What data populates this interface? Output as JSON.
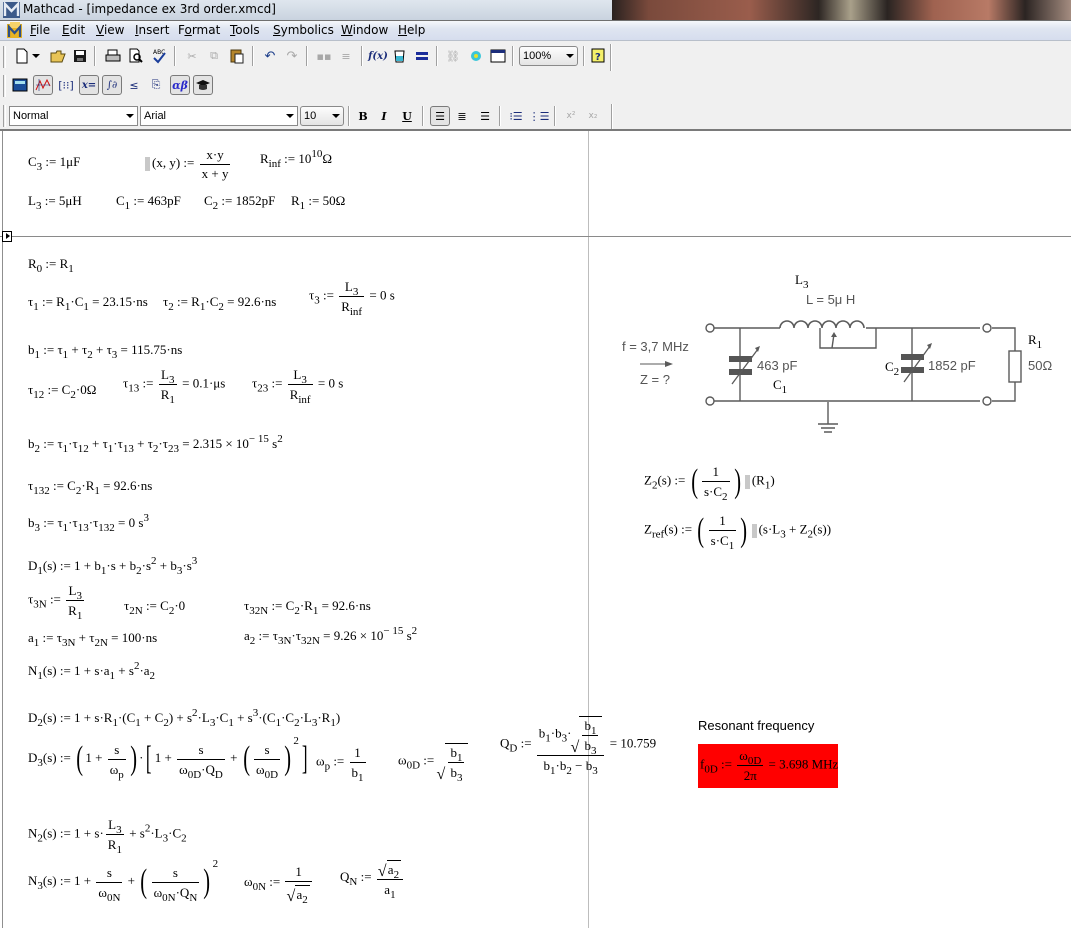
{
  "window": {
    "title": "Mathcad - [impedance ex 3rd order.xmcd]"
  },
  "menu": [
    {
      "label": "File",
      "accel": "F"
    },
    {
      "label": "Edit",
      "accel": "E"
    },
    {
      "label": "View",
      "accel": "V"
    },
    {
      "label": "Insert",
      "accel": "I"
    },
    {
      "label": "Format",
      "accel": "o"
    },
    {
      "label": "Tools",
      "accel": "T"
    },
    {
      "label": "Symbolics",
      "accel": "S"
    },
    {
      "label": "Window",
      "accel": "W"
    },
    {
      "label": "Help",
      "accel": "H"
    }
  ],
  "toolbar": {
    "zoom_value": "100%",
    "style_value": "Normal",
    "font_value": "Arial",
    "size_value": "10",
    "bold_label": "B",
    "italic_label": "I",
    "underline_label": "U"
  },
  "worksheet": {
    "defs_row1": {
      "c3": "C3 := 1μF",
      "parallel_def_args": "(x, y) :=",
      "parallel_num": "x·y",
      "parallel_den": "x + y",
      "rinf_lhs": "R",
      "rinf_sub": "inf",
      "rinf_rhs": " := 10",
      "rinf_exp": "10",
      "rinf_unit": "Ω"
    },
    "defs_row2": {
      "l3_value": "5μH",
      "c1_value": "463pF",
      "c2_value": "1852pF",
      "r1_value": "50Ω"
    },
    "results": {
      "tau1": "23.15·ns",
      "tau2": "92.6·ns",
      "tau3": "0 s",
      "b1": "115.75·ns",
      "tau13": "0.1·μs",
      "tau23": "0 s",
      "b2_mantissa": "2.315 × 10",
      "b2_exp": "− 15",
      "tau132": "92.6·ns",
      "b3": "0 s",
      "tau32N": "92.6·ns",
      "a1": "100·ns",
      "a2_mantissa": "9.26 × 10",
      "a2_exp": "− 15",
      "QD": "10.759",
      "f0D": "3.698 MHz"
    },
    "annotation": {
      "resonant_label": "Resonant frequency"
    },
    "circuit": {
      "inductor_name": "L",
      "inductor_sub": "3",
      "inductor_value": "L = 5μ H",
      "freq_label": "f = 3,7 MHz",
      "z_label": "Z = ?",
      "c1_value": "463 pF",
      "c1_name": "C",
      "c1_sub": "1",
      "c2_name": "C",
      "c2_sub": "2",
      "c2_value": "1852 pF",
      "r1_name": "R",
      "r1_sub": "1",
      "r1_value": "50Ω"
    },
    "highlight_color": "#ff0000"
  }
}
